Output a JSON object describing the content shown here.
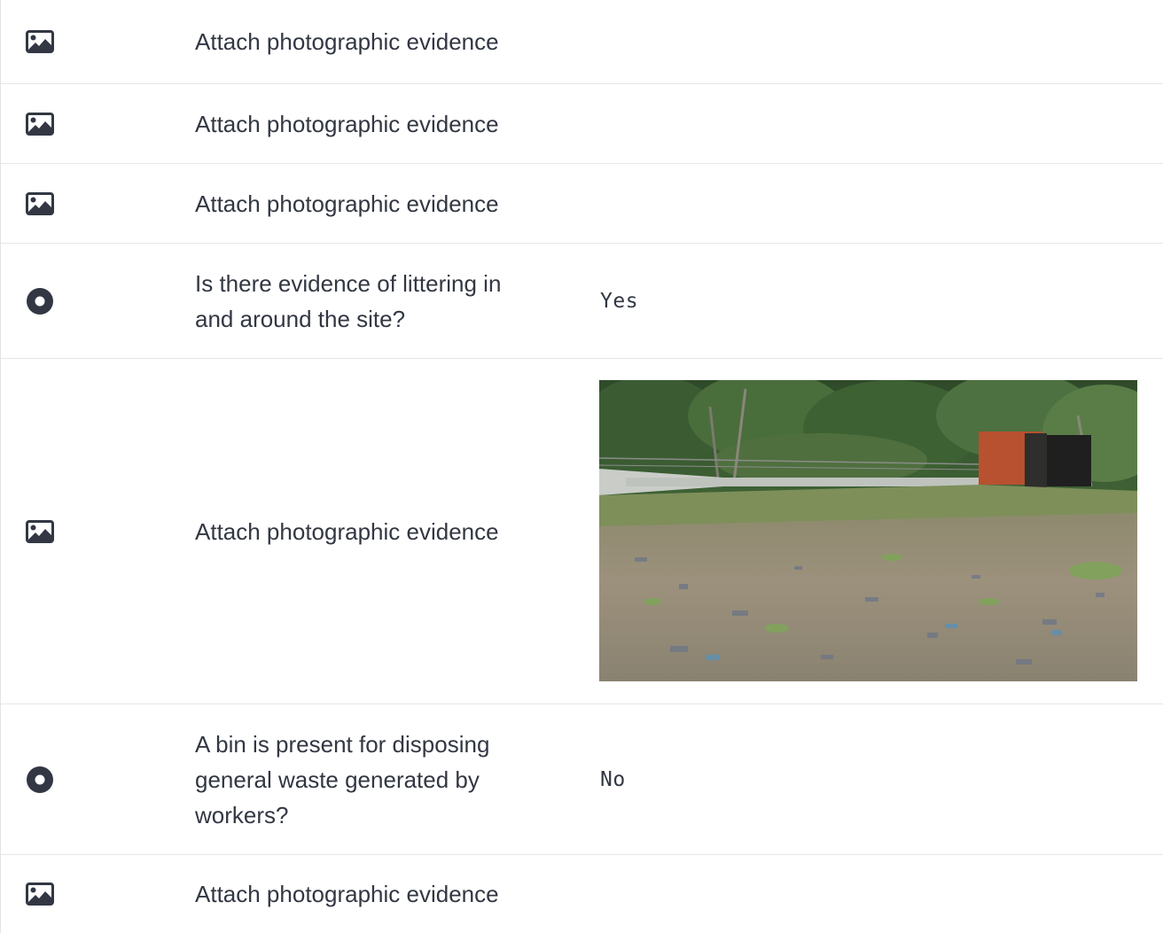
{
  "rows": [
    {
      "type": "image",
      "icon": "image-icon",
      "question": "Attach photographic evidence",
      "answer": ""
    },
    {
      "type": "image",
      "icon": "image-icon",
      "question": "Attach photographic evidence",
      "answer": ""
    },
    {
      "type": "image",
      "icon": "image-icon",
      "question": "Attach photographic evidence",
      "answer": ""
    },
    {
      "type": "radio",
      "icon": "radio-selected-icon",
      "question": "Is there evidence of littering in and around the site?",
      "answer": "Yes"
    },
    {
      "type": "image",
      "icon": "image-icon",
      "question": "Attach photographic evidence",
      "answer": "photo-littered-site"
    },
    {
      "type": "radio",
      "icon": "radio-selected-icon",
      "question": "A bin is present for disposing general waste generated by workers?",
      "answer": "No"
    },
    {
      "type": "image",
      "icon": "image-icon",
      "question": "Attach photographic evidence",
      "answer": ""
    }
  ],
  "colors": {
    "text": "#323743",
    "icon": "#323743",
    "divider": "#e6e6e6"
  }
}
